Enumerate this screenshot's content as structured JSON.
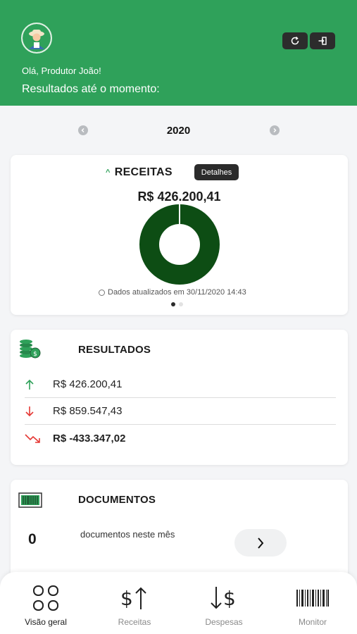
{
  "header": {
    "greeting": "Olá, Produtor João!",
    "subtitle": "Resultados até o momento:",
    "icons": [
      "refresh-icon",
      "logout-icon"
    ],
    "brand_color": "#2fa15a"
  },
  "year_selector": {
    "year": "2020"
  },
  "receitas": {
    "title": "RECEITAS",
    "details_label": "Detalhes",
    "amount": "R$ 426.200,41",
    "updated_text": "Dados atualizados em 30/11/2020 14:43",
    "donut_color": "#0d4d14",
    "donut_share": 1.0,
    "pages": 2,
    "active_page": 1
  },
  "resultados": {
    "title": "RESULTADOS",
    "rows": [
      {
        "value": "R$ 426.200,41",
        "icon": "arrow-up-icon",
        "color": "#2fa15a"
      },
      {
        "value": "R$ 859.547,43",
        "icon": "arrow-down-icon",
        "color": "#e53935"
      },
      {
        "value": "R$ -433.347,02",
        "icon": "trend-down-icon",
        "color": "#e53935"
      }
    ]
  },
  "documentos": {
    "title": "DOCUMENTOS",
    "count": "0",
    "text": "documentos neste mês"
  },
  "nav": {
    "items": [
      {
        "label": "Visão geral",
        "icon": "grid-icon",
        "active": true
      },
      {
        "label": "Receitas",
        "icon": "money-up-icon",
        "active": false
      },
      {
        "label": "Despesas",
        "icon": "money-down-icon",
        "active": false
      },
      {
        "label": "Monitor",
        "icon": "barcode-icon",
        "active": false
      }
    ]
  }
}
